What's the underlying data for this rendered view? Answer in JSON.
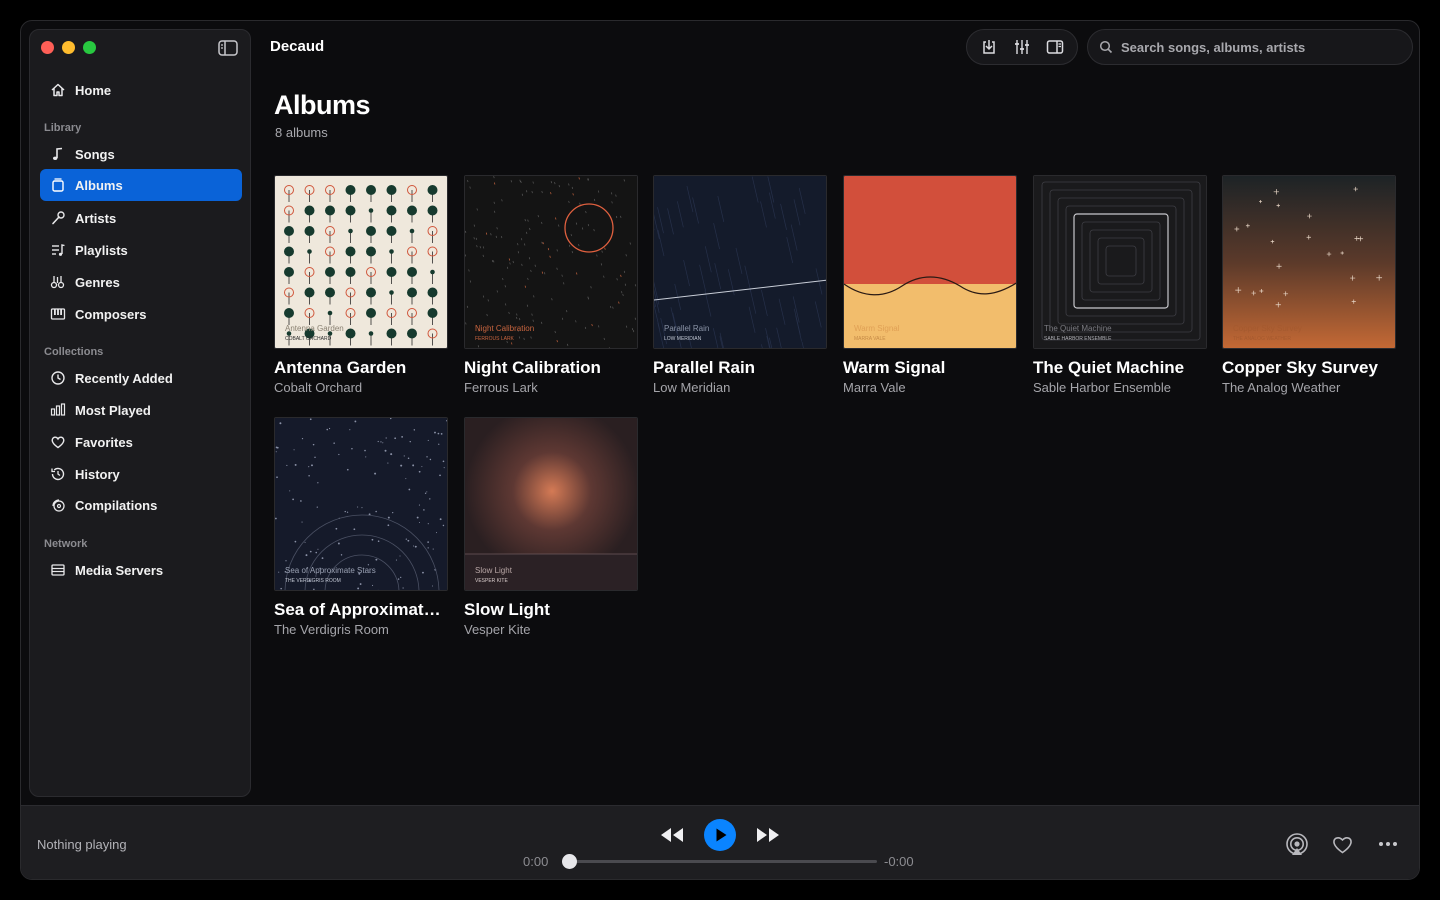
{
  "app": {
    "title": "Decaud"
  },
  "sidebar": {
    "home": "Home",
    "sections": {
      "library": "Library",
      "collections": "Collections",
      "network": "Network"
    },
    "library_items": [
      "Songs",
      "Albums",
      "Artists",
      "Playlists",
      "Genres",
      "Composers"
    ],
    "collection_items": [
      "Recently Added",
      "Most Played",
      "Favorites",
      "History",
      "Compilations"
    ],
    "network_items": [
      "Media Servers"
    ],
    "active": "Albums"
  },
  "search": {
    "placeholder": "Search songs, albums, artists"
  },
  "page": {
    "title": "Albums",
    "subtitle": "8 albums"
  },
  "albums": [
    {
      "title": "Antenna Garden",
      "artist": "Cobalt Orchard",
      "cover_text": "Antenna Garden",
      "cover_sub": "COBALT ORCHARD"
    },
    {
      "title": "Night Calibration",
      "artist": "Ferrous Lark",
      "cover_text": "Night Calibration",
      "cover_sub": "FERROUS LARK"
    },
    {
      "title": "Parallel Rain",
      "artist": "Low Meridian",
      "cover_text": "Parallel Rain",
      "cover_sub": "LOW MERIDIAN"
    },
    {
      "title": "Warm Signal",
      "artist": "Marra Vale",
      "cover_text": "Warm Signal",
      "cover_sub": "MARRA VALE"
    },
    {
      "title": "The Quiet Machine",
      "artist": "Sable Harbor Ensemble",
      "cover_text": "The Quiet Machine",
      "cover_sub": "SABLE HARBOR ENSEMBLE"
    },
    {
      "title": "Copper Sky Survey",
      "artist": "The Analog Weather",
      "cover_text": "Copper Sky Survey",
      "cover_sub": "THE ANALOG WEATHER"
    },
    {
      "title": "Sea of Approximate Stars",
      "artist": "The Verdigris Room",
      "cover_text": "Sea of Approximate Stars",
      "cover_sub": "THE VERDIGRIS ROOM"
    },
    {
      "title": "Slow Light",
      "artist": "Vesper Kite",
      "cover_text": "Slow Light",
      "cover_sub": "VESPER KITE"
    }
  ],
  "player": {
    "status": "Nothing playing",
    "elapsed": "0:00",
    "remaining": "-0:00",
    "progress": 0
  },
  "colors": {
    "accent": "#0a63d8",
    "play": "#0a84ff"
  }
}
